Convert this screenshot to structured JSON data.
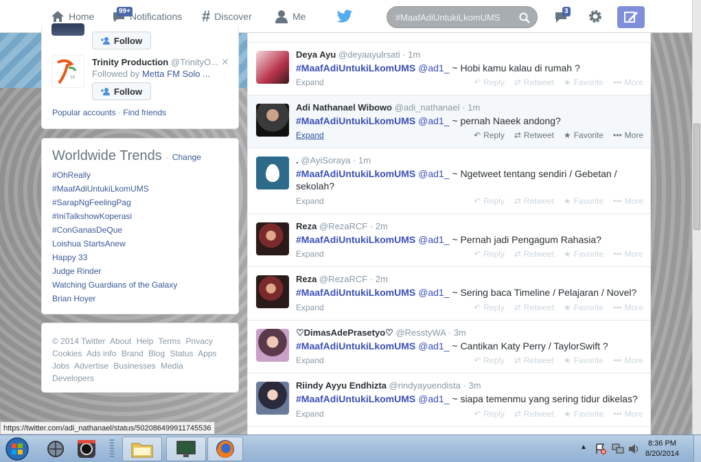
{
  "nav": {
    "home": "Home",
    "notifications": "Notifications",
    "notifications_badge": "99+",
    "discover": "Discover",
    "me": "Me",
    "search_value": "#MaafAdiUntukiLkomUMS",
    "messages_badge": "3"
  },
  "who_to_follow": {
    "follow_label": "Follow",
    "account": {
      "name": "Trinity Production",
      "handle": "@TrinityO...",
      "followed_by_prefix": "Followed by",
      "followed_by": "Metta FM Solo ..."
    },
    "popular_accounts": "Popular accounts",
    "separator": "·",
    "find_friends": "Find friends"
  },
  "trends": {
    "title": "Worldwide Trends",
    "change": "Change",
    "items": [
      "#OhReally",
      "#MaafAdiUntukiLkomUMS",
      "#SarapNgFeelingPag",
      "#IniTalkshowKoperasi",
      "#ConGanasDeQue",
      "Loishua StartsAnew",
      "Happy 33",
      "Judge Rinder",
      "Watching Guardians of the Galaxy",
      "Brian Hoyer"
    ]
  },
  "footer": {
    "copyright": "© 2014 Twitter",
    "links": [
      "About",
      "Help",
      "Terms",
      "Privacy",
      "Cookies",
      "Ads info",
      "Brand",
      "Blog",
      "Status",
      "Apps",
      "Jobs",
      "Advertise",
      "Businesses",
      "Media",
      "Developers"
    ]
  },
  "tweet_actions": {
    "expand": "Expand",
    "reply": "Reply",
    "retweet": "Retweet",
    "favorite": "Favorite",
    "more": "More"
  },
  "tweets": [
    {
      "name": "Deya Ayu",
      "handle": "@deyaayulrsati",
      "time": "1m",
      "hashtag": "#MaafAdiUntukiLkomUMS",
      "mention": "@ad1_",
      "text": " ~ Hobi kamu kalau di rumah ?"
    },
    {
      "name": "Adi Nathanael Wibowo",
      "handle": "@adi_nathanael",
      "time": "1m",
      "hashtag": "#MaafAdiUntukiLkomUMS",
      "mention": "@ad1_",
      "text": " ~ pernah Naeek andong?"
    },
    {
      "name": ".",
      "handle": "@AyiSoraya",
      "time": "1m",
      "hashtag": "#MaafAdiUntukiLkomUMS",
      "mention": "@ad1_",
      "text": " ~ Ngetweet tentang sendiri / Gebetan / sekolah?"
    },
    {
      "name": "Reza",
      "handle": "@RezaRCF",
      "time": "2m",
      "hashtag": "#MaafAdiUntukiLkomUMS",
      "mention": "@ad1_",
      "text": " ~ Pernah jadi Pengagum Rahasia?"
    },
    {
      "name": "Reza",
      "handle": "@RezaRCF",
      "time": "2m",
      "hashtag": "#MaafAdiUntukiLkomUMS",
      "mention": "@ad1_",
      "text": " ~ Sering baca Timeline / Pelajaran / Novel?"
    },
    {
      "name": "♡DimasAdePrasetyo♡",
      "handle": "@ResstyWA",
      "time": "3m",
      "hashtag": "#MaafAdiUntukiLkomUMS",
      "mention": "@ad1_",
      "text": " ~ Cantikan Katy Perry / TaylorSwift ?"
    },
    {
      "name": "Riindy Ayyu Endhizta",
      "handle": "@rindyayuendista",
      "time": "3m",
      "hashtag": "#MaafAdiUntukiLkomUMS",
      "mention": "@ad1_",
      "text": " ~ siapa temenmu yang sering tidur dikelas?"
    }
  ],
  "status_bar": {
    "url": "https://twitter.com/adi_nathanael/status/502086499911745536"
  },
  "taskbar": {
    "time": "8:36 PM",
    "date": "8/20/2014"
  },
  "colors": {
    "accent": "#3b4fb8",
    "link": "#3b5998",
    "compose": "#7f8fdc",
    "badge": "#4a67a8"
  }
}
